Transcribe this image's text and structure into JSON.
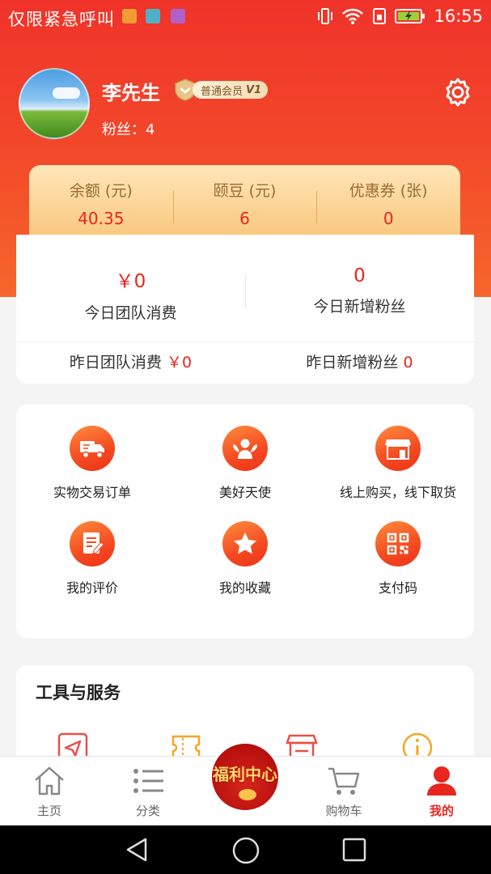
{
  "status_bar": {
    "carrier": "仅限紧急呼叫",
    "time": "16:55",
    "notification_icons": [
      "heart-app-icon",
      "gamepad-app-icon",
      "gallery-app-icon"
    ],
    "system_icons": [
      "vibrate-icon",
      "wifi-icon",
      "sim-icon",
      "battery-charging-icon"
    ]
  },
  "profile": {
    "name": "李先生",
    "member_level": "普通会员",
    "member_tier": "V1",
    "fans_label": "粉丝：",
    "fans_count": "4"
  },
  "wallet": [
    {
      "label": "余额 (元)",
      "value": "40.35"
    },
    {
      "label": "颐豆 (元)",
      "value": "6"
    },
    {
      "label": "优惠券 (张)",
      "value": "0"
    }
  ],
  "team": {
    "today_consumption_value": "￥0",
    "today_consumption_label": "今日团队消费",
    "today_fans_value": "0",
    "today_fans_label": "今日新增粉丝",
    "yesterday_consumption_label": "昨日团队消费",
    "yesterday_consumption_value": "￥0",
    "yesterday_fans_label": "昨日新增粉丝",
    "yesterday_fans_value": "0"
  },
  "menu": [
    {
      "label": "实物交易订单",
      "icon": "delivery-truck-icon"
    },
    {
      "label": "美好天使",
      "icon": "angel-icon"
    },
    {
      "label": "线上购买，线下取货",
      "icon": "store-icon"
    },
    {
      "label": "我的评价",
      "icon": "review-icon"
    },
    {
      "label": "我的收藏",
      "icon": "star-icon"
    },
    {
      "label": "支付码",
      "icon": "qr-code-icon"
    }
  ],
  "tools": {
    "title": "工具与服务",
    "icons": [
      "send-icon",
      "ticket-icon",
      "shop-icon",
      "info-icon"
    ]
  },
  "tabs": [
    {
      "label": "主页",
      "icon": "home-icon"
    },
    {
      "label": "分类",
      "icon": "list-icon"
    },
    {
      "label": "福利中心",
      "icon": "welfare-center-icon"
    },
    {
      "label": "购物车",
      "icon": "cart-icon"
    },
    {
      "label": "我的",
      "icon": "user-icon",
      "active": true
    }
  ],
  "colors": {
    "brand_red": "#e8251f",
    "hero_gradient_top": "#f0332a",
    "hero_gradient_bottom": "#f6662b",
    "wallet_gold": "#f8c477",
    "icon_orange": "#f44a22"
  }
}
